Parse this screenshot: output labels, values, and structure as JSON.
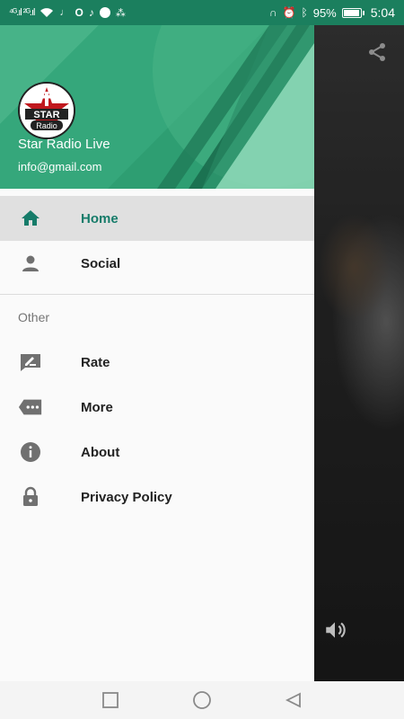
{
  "status_bar": {
    "left_indicators": "⁴ᴳ.ıl ²ᴳ.ıl",
    "battery_percent": "95%",
    "time": "5:04"
  },
  "drawer": {
    "header": {
      "logo_text_top": "STAR",
      "logo_text_bottom": "Radio",
      "title": "Star Radio Live",
      "email": "info@gmail.com",
      "accent": "#2e9e72"
    },
    "items": [
      {
        "label": "Home",
        "icon": "home-icon",
        "active": true
      },
      {
        "label": "Social",
        "icon": "person-icon",
        "active": false
      }
    ],
    "section_title": "Other",
    "other_items": [
      {
        "label": "Rate",
        "icon": "rate-icon"
      },
      {
        "label": "More",
        "icon": "more-icon"
      },
      {
        "label": "About",
        "icon": "info-icon"
      },
      {
        "label": "Privacy Policy",
        "icon": "lock-icon"
      }
    ]
  },
  "colors": {
    "active_text": "#167c6a",
    "status_bar": "#1b7f5e"
  }
}
